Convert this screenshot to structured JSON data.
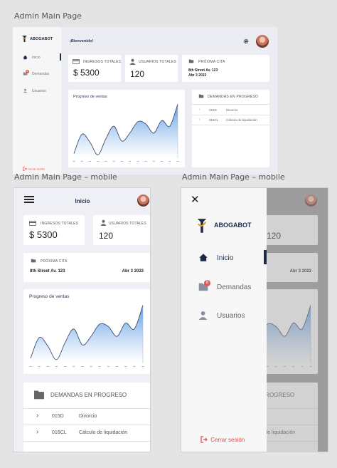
{
  "frames": {
    "desktop_title": "Admin Main Page",
    "mobile_title": "Admin Main Page – mobile",
    "mobile_menu_title": "Admin Main Page – mobile"
  },
  "brand": {
    "name": "ABOGABOT"
  },
  "greeting": "¡Bienvenido!",
  "nav": {
    "home": "Inicio",
    "claims": "Demandas",
    "users": "Usuarios",
    "claims_badge": "8"
  },
  "logout": "Cerrar sesión",
  "mobile_header": {
    "title": "Inicio"
  },
  "stats": {
    "revenue_label": "INGRESOS TOTALES",
    "revenue_value": "$ 5300",
    "users_label": "USUARIOS TOTALES",
    "users_value": "120"
  },
  "appointment": {
    "label": "PRÓXIMA CITA",
    "address": "8th Street Av. 123",
    "date": "Abr 3 2022"
  },
  "claims_panel": {
    "title": "DEMANDAS EN PROGRESO",
    "rows": [
      {
        "code": "015D",
        "name": "Divorcio"
      },
      {
        "code": "016CL",
        "name": "Cálculo de liquidación"
      }
    ]
  },
  "chart_data": {
    "type": "area",
    "title": "Progreso de ventas",
    "x": [
      1,
      2,
      3,
      4,
      5,
      6,
      7,
      8,
      9,
      10,
      11,
      12,
      13,
      14
    ],
    "values": [
      8,
      42,
      28,
      6,
      34,
      56,
      30,
      44,
      64,
      60,
      44,
      66,
      56,
      95
    ],
    "ylim": [
      0,
      100
    ],
    "grid": false,
    "colors": {
      "line": "#2b3f5c",
      "fill_top": "#4a90e2",
      "fill_bottom": "#ffffff"
    }
  },
  "colors": {
    "accent": "#4a90e2",
    "navy": "#1f2b46",
    "logout": "#e04848",
    "badge": "#e05858"
  }
}
